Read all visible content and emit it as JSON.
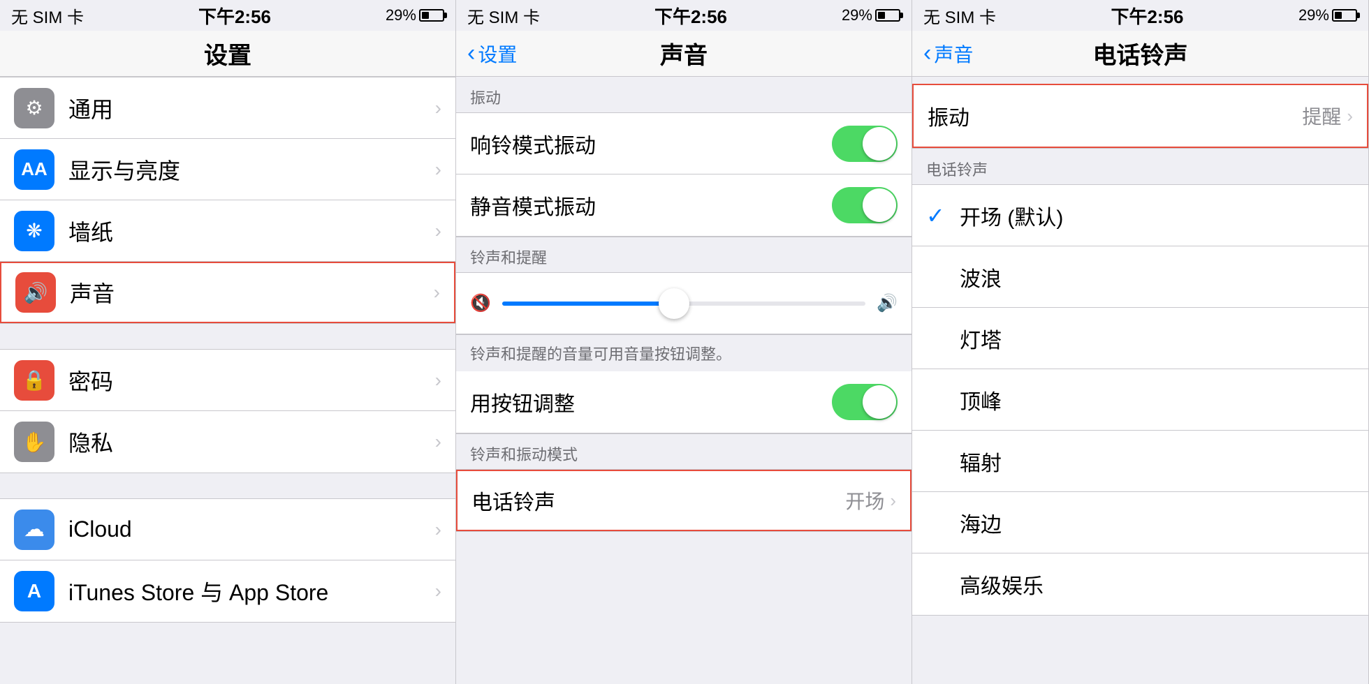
{
  "panels": [
    {
      "id": "settings",
      "statusBar": {
        "left": "无 SIM 卡",
        "center": "下午2:56",
        "batteryPct": "29%"
      },
      "navTitle": "设置",
      "groups": [
        {
          "items": [
            {
              "id": "general",
              "label": "通用",
              "iconBg": "#8e8e93",
              "iconChar": "⚙"
            },
            {
              "id": "display",
              "label": "显示与亮度",
              "iconBg": "#007aff",
              "iconChar": "AA"
            },
            {
              "id": "wallpaper",
              "label": "墙纸",
              "iconBg": "#007aff",
              "iconChar": "❋"
            },
            {
              "id": "sound",
              "label": "声音",
              "iconBg": "#e74c3c",
              "iconChar": "🔊",
              "highlighted": true
            }
          ]
        },
        {
          "items": [
            {
              "id": "passcode",
              "label": "密码",
              "iconBg": "#e74c3c",
              "iconChar": "🔒"
            },
            {
              "id": "privacy",
              "label": "隐私",
              "iconBg": "#8e8e93",
              "iconChar": "✋"
            }
          ]
        },
        {
          "items": [
            {
              "id": "icloud",
              "label": "iCloud",
              "iconBg": "#3b8beb",
              "iconChar": "☁"
            },
            {
              "id": "itunes",
              "label": "iTunes Store 与 App Store",
              "iconBg": "#007aff",
              "iconChar": "A"
            }
          ]
        }
      ]
    },
    {
      "id": "sound",
      "statusBar": {
        "left": "无 SIM 卡",
        "center": "下午2:56",
        "batteryPct": "29%"
      },
      "navBack": "设置",
      "navTitle": "声音",
      "sections": [
        {
          "header": "振动",
          "items": [
            {
              "id": "ring-vibrate",
              "label": "响铃模式振动",
              "toggle": true
            },
            {
              "id": "silent-vibrate",
              "label": "静音模式振动",
              "toggle": true
            }
          ]
        },
        {
          "header": "铃声和提醒",
          "items": [],
          "hasSlider": true,
          "note": "铃声和提醒的音量可用音量按钮调整。"
        },
        {
          "header": "铃声和振动模式",
          "items": [
            {
              "id": "ringtone",
              "label": "电话铃声",
              "value": "开场",
              "highlighted": true
            }
          ]
        }
      ]
    },
    {
      "id": "ringtone",
      "statusBar": {
        "left": "无 SIM 卡",
        "center": "下午2:56",
        "batteryPct": "29%"
      },
      "navBack": "声音",
      "navTitle": "电话铃声",
      "vibrate": {
        "label": "振动",
        "value": "提醒",
        "highlighted": true
      },
      "sectionHeader": "电话铃声",
      "tones": [
        {
          "id": "kaichang",
          "label": "开场 (默认)",
          "checked": true
        },
        {
          "id": "bolang",
          "label": "波浪",
          "checked": false
        },
        {
          "id": "dengta",
          "label": "灯塔",
          "checked": false
        },
        {
          "id": "dingfeng",
          "label": "顶峰",
          "checked": false
        },
        {
          "id": "fushe",
          "label": "辐射",
          "checked": false
        },
        {
          "id": "haibian",
          "label": "海边",
          "checked": false
        },
        {
          "id": "gaojiyule",
          "label": "高级娱乐",
          "checked": false
        }
      ]
    }
  ]
}
